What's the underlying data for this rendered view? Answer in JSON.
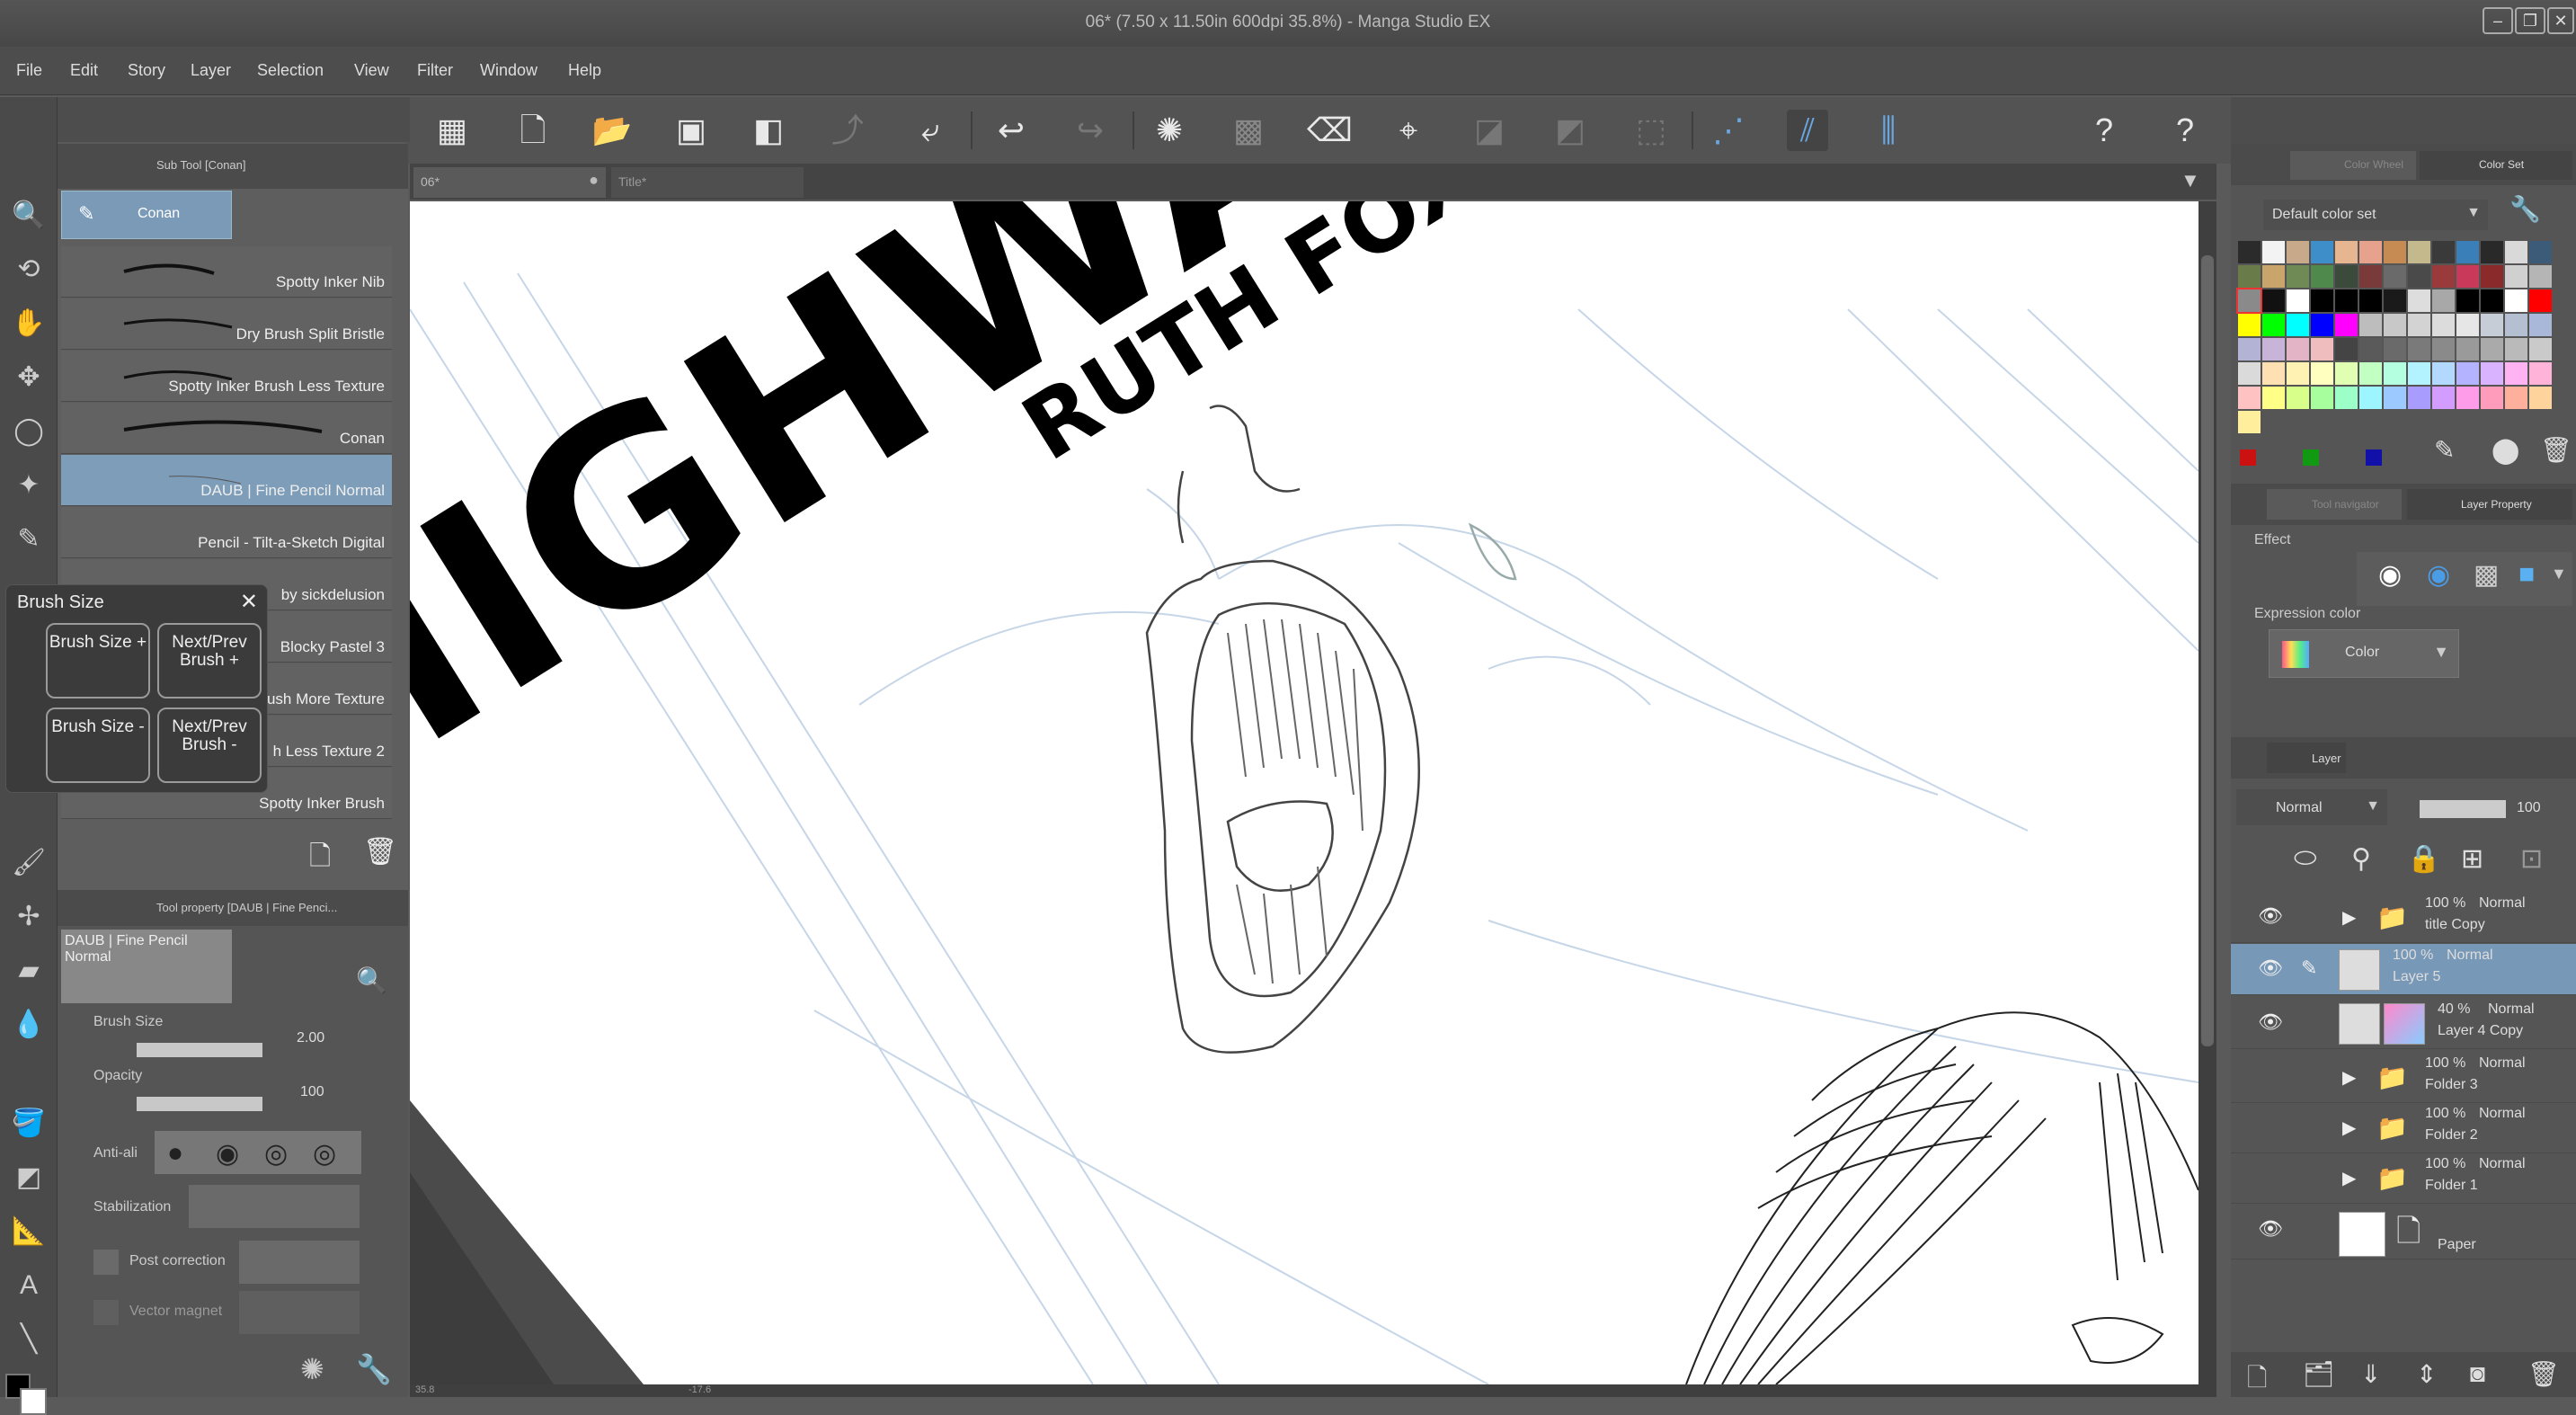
{
  "window": {
    "title": "06* (7.50 x 11.50in 600dpi 35.8%) - Manga Studio EX",
    "min": "–",
    "max": "❐",
    "close": "✕"
  },
  "menu": [
    "File",
    "Edit",
    "Story",
    "Layer",
    "Selection",
    "View",
    "Filter",
    "Window",
    "Help"
  ],
  "subtool": {
    "header": "Sub Tool [Conan]",
    "active": "Conan",
    "brushes": [
      "Spotty Inker Nib",
      "Dry Brush Split Bristle",
      "Spotty Inker Brush Less Texture",
      "Conan",
      "DAUB | Fine Pencil Normal",
      "Pencil - Tilt-a-Sketch Digital",
      "by sickdelusion",
      "Blocky Pastel 3",
      "ush More Texture",
      "h Less Texture 2",
      "Spotty Inker Brush"
    ]
  },
  "brush_size_popup": {
    "title": "Brush Size",
    "close": "✕",
    "buttons": [
      "Brush Size +",
      "Next/Prev Brush +",
      "Brush Size -",
      "Next/Prev Brush -"
    ]
  },
  "tool_property": {
    "header": "Tool property [DAUB | Fine Penci...",
    "preset": "DAUB | Fine Pencil Normal",
    "brush_size_label": "Brush Size",
    "brush_size_value": "2.00",
    "opacity_label": "Opacity",
    "opacity_value": "100",
    "antialias_label": "Anti-ali",
    "stabilization_label": "Stabilization",
    "post_correction_label": "Post correction",
    "vector_magnet_label": "Vector magnet"
  },
  "canvas": {
    "tabs": [
      "06*",
      "Title*"
    ],
    "title_art": "HIGHWA",
    "byline": "RUTH FOX • CO"
  },
  "color_panel": {
    "tab1": "Color Wheel",
    "tab2": "Color Set",
    "set_name": "Default color set",
    "colors": [
      "#2b2b2b",
      "#f3f3f3",
      "#c8a989",
      "#3d8ec9",
      "#e5b68f",
      "#e6a28c",
      "#c58b52",
      "#c4b88d",
      "#3a3a3a",
      "#3b7fb8",
      "#292929",
      "#d9d9d9",
      "#3c5b78",
      "#6a7b4a",
      "#c9a46b",
      "#6f8a54",
      "#4f8a4c",
      "#3b4a3a",
      "#7a3a3a",
      "#6a6a6a",
      "#4a4a4a",
      "#9a3a3a",
      "#c93a5a",
      "#8a2a2a",
      "#d0d0d0",
      "#b5b5b5",
      "#8a8a8a",
      "#111111",
      "#ffffff",
      "#000000",
      "#000000",
      "#000000",
      "#1a1a1a",
      "#dddddd",
      "#a8a8a8",
      "#000000",
      "#000000",
      "#ffffff",
      "#ff0000",
      "#ffff00",
      "#00ff00",
      "#00ffff",
      "#0000ff",
      "#ff00ff",
      "#bdbdbd",
      "#c8c8c8",
      "#d3d3d3",
      "#dcdcdc",
      "#e6e6e6",
      "#c7cdd6",
      "#b4bfd2",
      "#a9b7d8",
      "#b3b3d6",
      "#c8b3d9",
      "#e3b3c6",
      "#efbdbd",
      "#444444",
      "#5a5a5a",
      "#6a6a6a",
      "#7a7a7a",
      "#8a8a8a",
      "#9a9a9a",
      "#aaaaaa",
      "#bababa",
      "#cacaca",
      "#dadada",
      "#ffe0b3",
      "#fff2b3",
      "#ffffbf",
      "#e0ffb3",
      "#c2ffc2",
      "#b3ffe0",
      "#b3f2ff",
      "#b3d9ff",
      "#b3b3ff",
      "#d9b3ff",
      "#ffb3f2",
      "#ffb3d9",
      "#ffc2c2",
      "#ffff88",
      "#d8ff8a",
      "#a6ff9c",
      "#9cffc8",
      "#9cf5ff",
      "#9cc9ff",
      "#a89cff",
      "#d39cff",
      "#ff9cea",
      "#ff9cbc",
      "#ffb09c",
      "#ffd39c",
      "#ffee9c"
    ],
    "recent": [
      "#cc1111",
      "#119911",
      "#1111aa"
    ]
  },
  "layer_property": {
    "tab1": "Tool navigator",
    "tab2": "Layer Property",
    "effect_label": "Effect",
    "expression_label": "Expression color",
    "expression_value": "Color"
  },
  "layers": {
    "tab": "Layer",
    "blend": "Normal",
    "opacity": "100",
    "rows": [
      {
        "pct": "100 %",
        "mode": "Normal",
        "name": "title Copy",
        "type": "folder",
        "visible": true
      },
      {
        "pct": "100 %",
        "mode": "Normal",
        "name": "Layer 5",
        "type": "raster",
        "visible": true,
        "selected": true
      },
      {
        "pct": "40 %",
        "mode": "Normal",
        "name": "Layer 4 Copy",
        "type": "raster",
        "visible": true
      },
      {
        "pct": "100 %",
        "mode": "Normal",
        "name": "Folder 3",
        "type": "folder",
        "visible": false
      },
      {
        "pct": "100 %",
        "mode": "Normal",
        "name": "Folder 2",
        "type": "folder",
        "visible": false
      },
      {
        "pct": "100 %",
        "mode": "Normal",
        "name": "Folder 1",
        "type": "folder",
        "visible": false
      },
      {
        "pct": "",
        "mode": "",
        "name": "Paper",
        "type": "paper",
        "visible": true
      }
    ]
  },
  "status": {
    "zoom": "35.8",
    "angle": "-17.6"
  }
}
